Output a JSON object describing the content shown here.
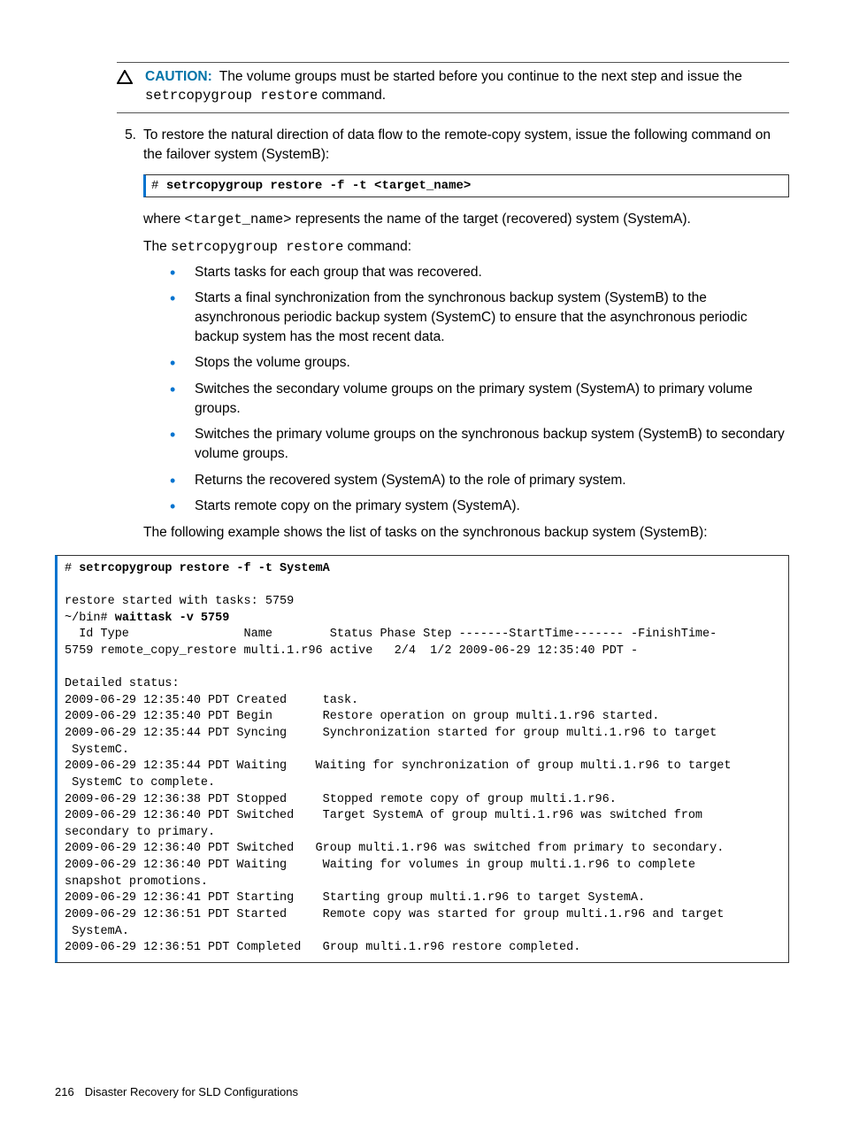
{
  "caution": {
    "label": "CAUTION:",
    "text_prefix": "The volume groups must be started before you continue to the next step and issue the ",
    "code": "setrcopygroup restore",
    "text_suffix": " command."
  },
  "step": {
    "number": "5.",
    "text": "To restore the natural direction of data flow to the remote-copy system, issue the following command on the failover system (SystemB):"
  },
  "code1": {
    "prefix": "# ",
    "bold": "setrcopygroup restore -f -t <target_name>"
  },
  "after_code1_line1_prefix": "where ",
  "after_code1_line1_code": "<target_name>",
  "after_code1_line1_suffix": " represents the name of the target (recovered) system (SystemA).",
  "after_code1_line2_prefix": "The ",
  "after_code1_line2_code": "setrcopygroup restore",
  "after_code1_line2_suffix": " command:",
  "bullets": [
    "Starts tasks for each group that was recovered.",
    "Starts a final synchronization from the synchronous backup system (SystemB) to the asynchronous periodic backup system (SystemC) to ensure that the asynchronous periodic backup system has the most recent data.",
    "Stops the volume groups.",
    "Switches the secondary volume groups on the primary system (SystemA) to primary volume groups.",
    "Switches the primary volume groups on the synchronous backup system (SystemB) to secondary volume groups.",
    "Returns the recovered system (SystemA) to the role of primary system.",
    "Starts remote copy on the primary system (SystemA)."
  ],
  "after_bullets": "The following example shows the list of tasks on the synchronous backup system (SystemB):",
  "big_code": {
    "l1_prefix": "# ",
    "l1_bold": "setrcopygroup restore -f -t SystemA",
    "l2": "",
    "l3": "restore started with tasks: 5759",
    "l4_prefix": "~/bin# ",
    "l4_bold": "waittask -v 5759",
    "l5": "  Id Type                Name        Status Phase Step -------StartTime------- -FinishTime-",
    "l6": "5759 remote_copy_restore multi.1.r96 active   2/4  1/2 2009-06-29 12:35:40 PDT -",
    "l7": "",
    "l8": "Detailed status:",
    "l9": "2009-06-29 12:35:40 PDT Created     task.",
    "l10": "2009-06-29 12:35:40 PDT Begin       Restore operation on group multi.1.r96 started.",
    "l11": "2009-06-29 12:35:44 PDT Syncing     Synchronization started for group multi.1.r96 to target",
    "l12": " SystemC.",
    "l13": "2009-06-29 12:35:44 PDT Waiting    Waiting for synchronization of group multi.1.r96 to target",
    "l14": " SystemC to complete.",
    "l15": "2009-06-29 12:36:38 PDT Stopped     Stopped remote copy of group multi.1.r96.",
    "l16": "2009-06-29 12:36:40 PDT Switched    Target SystemA of group multi.1.r96 was switched from ",
    "l17": "secondary to primary.",
    "l18": "2009-06-29 12:36:40 PDT Switched   Group multi.1.r96 was switched from primary to secondary.",
    "l19": "2009-06-29 12:36:40 PDT Waiting     Waiting for volumes in group multi.1.r96 to complete ",
    "l20": "snapshot promotions.",
    "l21": "2009-06-29 12:36:41 PDT Starting    Starting group multi.1.r96 to target SystemA.",
    "l22": "2009-06-29 12:36:51 PDT Started     Remote copy was started for group multi.1.r96 and target",
    "l23": " SystemA.",
    "l24": "2009-06-29 12:36:51 PDT Completed   Group multi.1.r96 restore completed."
  },
  "footer": {
    "page": "216",
    "title": "Disaster Recovery for SLD Configurations"
  }
}
